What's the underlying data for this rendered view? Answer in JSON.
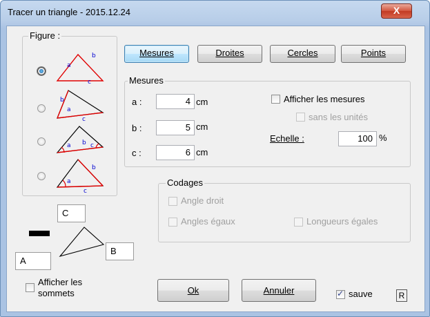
{
  "window": {
    "title": "Tracer un triangle - 2015.12.24",
    "close_symbol": "X"
  },
  "figure": {
    "legend": "Figure :",
    "options": [
      {
        "selected": true,
        "marks": [
          "a",
          "b",
          "c"
        ]
      },
      {
        "selected": false,
        "marks": [
          "b",
          "a",
          "c"
        ]
      },
      {
        "selected": false,
        "marks": [
          "a",
          "b",
          "c"
        ]
      },
      {
        "selected": false,
        "marks": [
          "a",
          "b",
          "c"
        ]
      }
    ]
  },
  "tabs": [
    {
      "label": "Mesures",
      "underline": "M",
      "active": true
    },
    {
      "label": "Droites",
      "underline": "D",
      "active": false
    },
    {
      "label": "Cercles",
      "underline": "C",
      "active": false
    },
    {
      "label": "Points",
      "underline": "P",
      "active": false
    }
  ],
  "mesures": {
    "legend": "Mesures",
    "rows": [
      {
        "label": "a :",
        "value": "4",
        "unit": "cm"
      },
      {
        "label": "b :",
        "value": "5",
        "unit": "cm"
      },
      {
        "label": "c :",
        "value": "6",
        "unit": "cm"
      }
    ],
    "afficher_mesures": "Afficher les mesures",
    "sans_unites": "sans les unités",
    "echelle_label": "Echelle :",
    "echelle_value": "100",
    "echelle_unit": "%"
  },
  "codages": {
    "legend": "Codages",
    "angle_droit": "Angle droit",
    "angles_egaux": "Angles égaux",
    "longueurs_egales": "Longueurs égales"
  },
  "vertices": {
    "a": "A",
    "b": "B",
    "c": "C"
  },
  "afficher_sommets": {
    "line1": "Afficher les",
    "line2": "sommets"
  },
  "footer": {
    "ok": "Ok",
    "annuler": "Annuler",
    "sauve": "sauve",
    "r": "R"
  },
  "colors": {
    "triangle": "#e00000",
    "marks": "#0000d0",
    "accent": "#3c7fb1"
  }
}
